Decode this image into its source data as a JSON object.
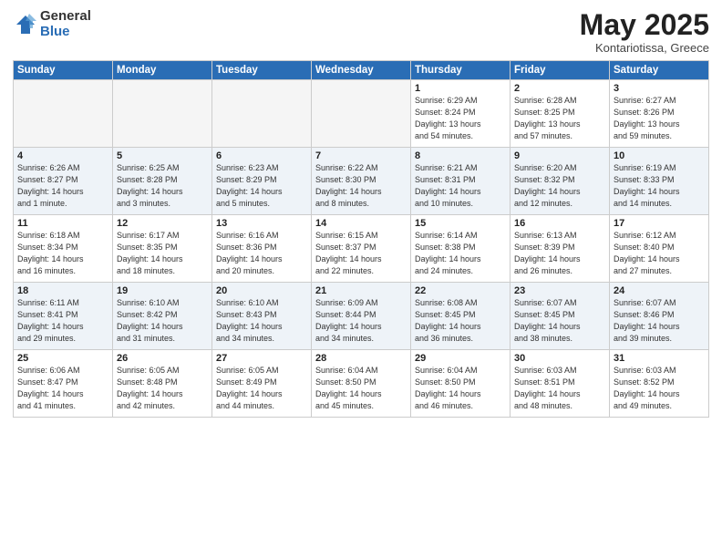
{
  "header": {
    "logo_general": "General",
    "logo_blue": "Blue",
    "title": "May 2025",
    "location": "Kontariotissa, Greece"
  },
  "weekdays": [
    "Sunday",
    "Monday",
    "Tuesday",
    "Wednesday",
    "Thursday",
    "Friday",
    "Saturday"
  ],
  "weeks": [
    [
      {
        "day": "",
        "info": ""
      },
      {
        "day": "",
        "info": ""
      },
      {
        "day": "",
        "info": ""
      },
      {
        "day": "",
        "info": ""
      },
      {
        "day": "1",
        "info": "Sunrise: 6:29 AM\nSunset: 8:24 PM\nDaylight: 13 hours\nand 54 minutes."
      },
      {
        "day": "2",
        "info": "Sunrise: 6:28 AM\nSunset: 8:25 PM\nDaylight: 13 hours\nand 57 minutes."
      },
      {
        "day": "3",
        "info": "Sunrise: 6:27 AM\nSunset: 8:26 PM\nDaylight: 13 hours\nand 59 minutes."
      }
    ],
    [
      {
        "day": "4",
        "info": "Sunrise: 6:26 AM\nSunset: 8:27 PM\nDaylight: 14 hours\nand 1 minute."
      },
      {
        "day": "5",
        "info": "Sunrise: 6:25 AM\nSunset: 8:28 PM\nDaylight: 14 hours\nand 3 minutes."
      },
      {
        "day": "6",
        "info": "Sunrise: 6:23 AM\nSunset: 8:29 PM\nDaylight: 14 hours\nand 5 minutes."
      },
      {
        "day": "7",
        "info": "Sunrise: 6:22 AM\nSunset: 8:30 PM\nDaylight: 14 hours\nand 8 minutes."
      },
      {
        "day": "8",
        "info": "Sunrise: 6:21 AM\nSunset: 8:31 PM\nDaylight: 14 hours\nand 10 minutes."
      },
      {
        "day": "9",
        "info": "Sunrise: 6:20 AM\nSunset: 8:32 PM\nDaylight: 14 hours\nand 12 minutes."
      },
      {
        "day": "10",
        "info": "Sunrise: 6:19 AM\nSunset: 8:33 PM\nDaylight: 14 hours\nand 14 minutes."
      }
    ],
    [
      {
        "day": "11",
        "info": "Sunrise: 6:18 AM\nSunset: 8:34 PM\nDaylight: 14 hours\nand 16 minutes."
      },
      {
        "day": "12",
        "info": "Sunrise: 6:17 AM\nSunset: 8:35 PM\nDaylight: 14 hours\nand 18 minutes."
      },
      {
        "day": "13",
        "info": "Sunrise: 6:16 AM\nSunset: 8:36 PM\nDaylight: 14 hours\nand 20 minutes."
      },
      {
        "day": "14",
        "info": "Sunrise: 6:15 AM\nSunset: 8:37 PM\nDaylight: 14 hours\nand 22 minutes."
      },
      {
        "day": "15",
        "info": "Sunrise: 6:14 AM\nSunset: 8:38 PM\nDaylight: 14 hours\nand 24 minutes."
      },
      {
        "day": "16",
        "info": "Sunrise: 6:13 AM\nSunset: 8:39 PM\nDaylight: 14 hours\nand 26 minutes."
      },
      {
        "day": "17",
        "info": "Sunrise: 6:12 AM\nSunset: 8:40 PM\nDaylight: 14 hours\nand 27 minutes."
      }
    ],
    [
      {
        "day": "18",
        "info": "Sunrise: 6:11 AM\nSunset: 8:41 PM\nDaylight: 14 hours\nand 29 minutes."
      },
      {
        "day": "19",
        "info": "Sunrise: 6:10 AM\nSunset: 8:42 PM\nDaylight: 14 hours\nand 31 minutes."
      },
      {
        "day": "20",
        "info": "Sunrise: 6:10 AM\nSunset: 8:43 PM\nDaylight: 14 hours\nand 34 minutes."
      },
      {
        "day": "21",
        "info": "Sunrise: 6:09 AM\nSunset: 8:44 PM\nDaylight: 14 hours\nand 34 minutes."
      },
      {
        "day": "22",
        "info": "Sunrise: 6:08 AM\nSunset: 8:45 PM\nDaylight: 14 hours\nand 36 minutes."
      },
      {
        "day": "23",
        "info": "Sunrise: 6:07 AM\nSunset: 8:45 PM\nDaylight: 14 hours\nand 38 minutes."
      },
      {
        "day": "24",
        "info": "Sunrise: 6:07 AM\nSunset: 8:46 PM\nDaylight: 14 hours\nand 39 minutes."
      }
    ],
    [
      {
        "day": "25",
        "info": "Sunrise: 6:06 AM\nSunset: 8:47 PM\nDaylight: 14 hours\nand 41 minutes."
      },
      {
        "day": "26",
        "info": "Sunrise: 6:05 AM\nSunset: 8:48 PM\nDaylight: 14 hours\nand 42 minutes."
      },
      {
        "day": "27",
        "info": "Sunrise: 6:05 AM\nSunset: 8:49 PM\nDaylight: 14 hours\nand 44 minutes."
      },
      {
        "day": "28",
        "info": "Sunrise: 6:04 AM\nSunset: 8:50 PM\nDaylight: 14 hours\nand 45 minutes."
      },
      {
        "day": "29",
        "info": "Sunrise: 6:04 AM\nSunset: 8:50 PM\nDaylight: 14 hours\nand 46 minutes."
      },
      {
        "day": "30",
        "info": "Sunrise: 6:03 AM\nSunset: 8:51 PM\nDaylight: 14 hours\nand 48 minutes."
      },
      {
        "day": "31",
        "info": "Sunrise: 6:03 AM\nSunset: 8:52 PM\nDaylight: 14 hours\nand 49 minutes."
      }
    ]
  ]
}
